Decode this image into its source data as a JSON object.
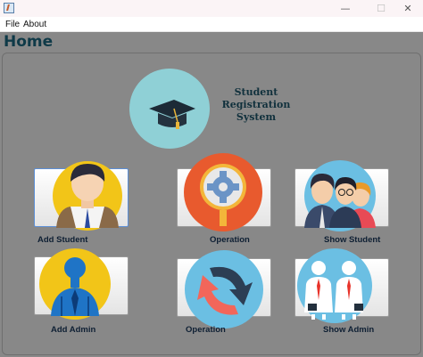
{
  "window": {
    "minimize_glyph": "—",
    "maximize_glyph": "☐",
    "close_glyph": "✕"
  },
  "menu": {
    "file": "File",
    "about": "About"
  },
  "page": {
    "title": "Home"
  },
  "logo": {
    "icon": "graduation-cap-icon",
    "title_lines": [
      "Student",
      "Registration",
      "System"
    ]
  },
  "tiles": [
    {
      "label": "Add Student",
      "icon": "student-icon"
    },
    {
      "label": "Operation",
      "icon": "gear-magnifier-icon"
    },
    {
      "label": "Show Student",
      "icon": "students-group-icon"
    },
    {
      "label": "Add Admin",
      "icon": "admin-icon"
    },
    {
      "label": "Operation",
      "icon": "cycle-arrows-icon"
    },
    {
      "label": "Show Admin",
      "icon": "admins-group-icon"
    }
  ],
  "colors": {
    "title": "#0f3a48",
    "background": "#888888",
    "logo_circle": "#8fd0d6"
  }
}
